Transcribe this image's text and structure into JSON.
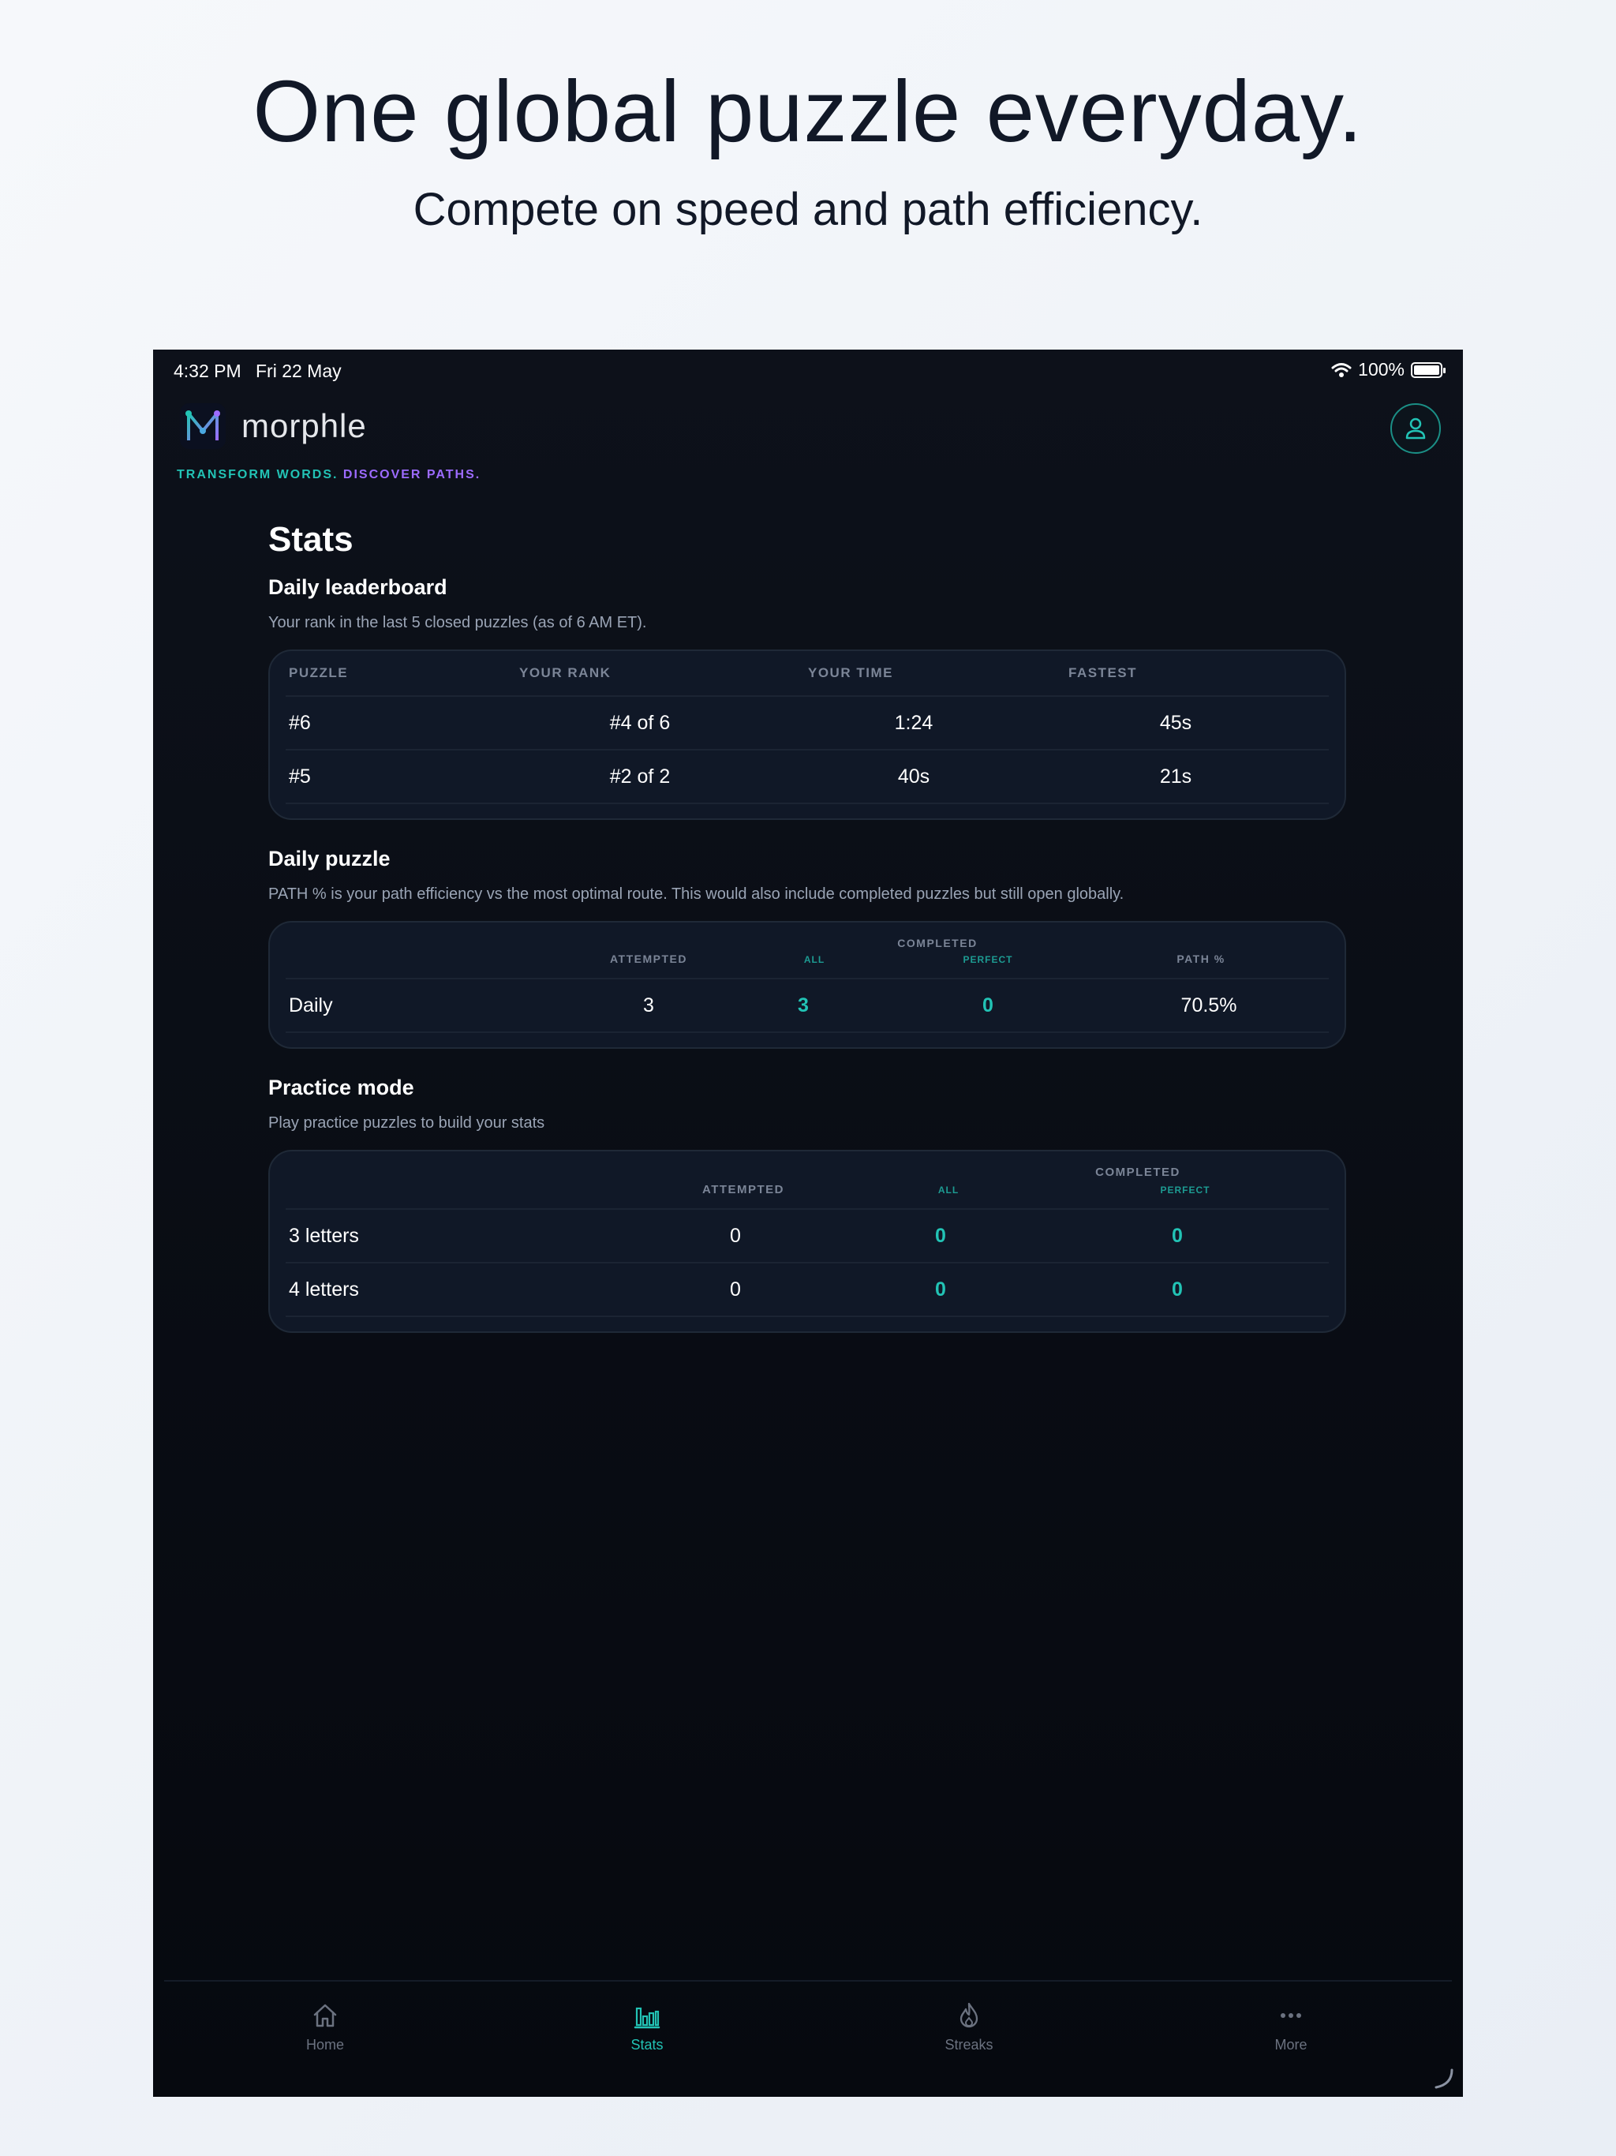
{
  "hero": {
    "title": "One global puzzle everyday.",
    "subtitle": "Compete on speed and path efficiency."
  },
  "status": {
    "time": "4:32 PM",
    "date": "Fri 22 May",
    "battery": "100%"
  },
  "app": {
    "name": "morphle",
    "tagline_a": "TRANSFORM WORDS.",
    "tagline_b": "DISCOVER PATHS."
  },
  "colors": {
    "accent": "#22c3b5",
    "purple": "#9d6bff",
    "bg": "#0d111a"
  },
  "stats": {
    "title": "Stats",
    "leaderboard": {
      "title": "Daily leaderboard",
      "desc": "Your rank in the last 5 closed puzzles (as of 6 AM ET).",
      "headers": [
        "PUZZLE",
        "YOUR RANK",
        "YOUR TIME",
        "FASTEST"
      ],
      "rows": [
        [
          "#6",
          "#4 of 6",
          "1:24",
          "45s"
        ],
        [
          "#5",
          "#2 of 2",
          "40s",
          "21s"
        ]
      ]
    },
    "daily": {
      "title": "Daily puzzle",
      "desc": "PATH % is your path efficiency vs the most optimal route. This would also include completed puzzles but still open globally.",
      "headers": {
        "attempted": "ATTEMPTED",
        "completed": "COMPLETED",
        "all": "ALL",
        "perfect": "PERFECT",
        "path": "PATH %"
      },
      "row": {
        "label": "Daily",
        "attempted": "3",
        "all": "3",
        "perfect": "0",
        "path": "70.5%"
      }
    },
    "practice": {
      "title": "Practice mode",
      "desc": "Play practice puzzles to build your stats",
      "headers": {
        "attempted": "ATTEMPTED",
        "completed": "COMPLETED",
        "all": "ALL",
        "perfect": "PERFECT"
      },
      "rows": [
        {
          "label": "3 letters",
          "attempted": "0",
          "all": "0",
          "perfect": "0"
        },
        {
          "label": "4 letters",
          "attempted": "0",
          "all": "0",
          "perfect": "0"
        }
      ]
    }
  },
  "tabs": [
    {
      "label": "Home",
      "icon": "home-icon"
    },
    {
      "label": "Stats",
      "icon": "bar-chart-icon",
      "active": true
    },
    {
      "label": "Streaks",
      "icon": "flame-icon"
    },
    {
      "label": "More",
      "icon": "ellipsis-icon"
    }
  ]
}
